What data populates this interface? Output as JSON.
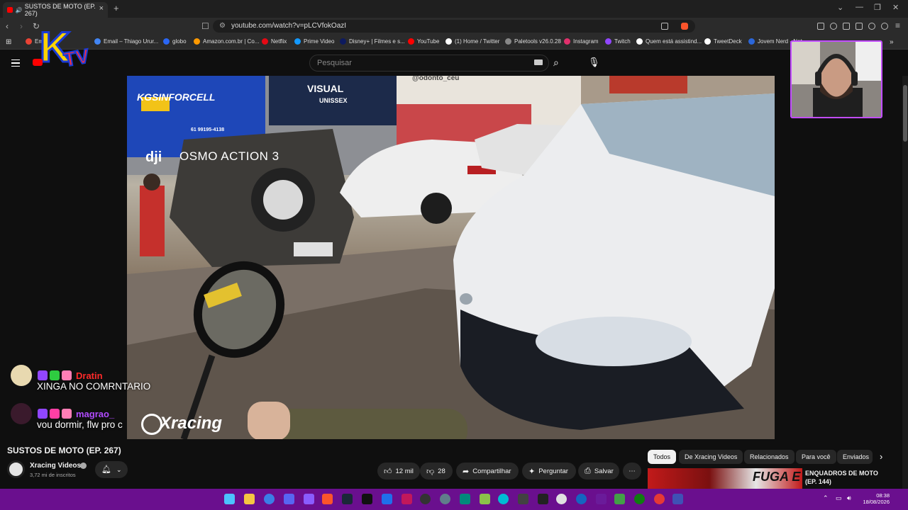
{
  "browser": {
    "tab_title": "SUSTOS DE MOTO (EP. 267)",
    "new_tab_symbol": "+",
    "url": "youtube.com/watch?v=pLCVfokOazI",
    "bookmarks": [
      {
        "label": "Em",
        "color": "#ea4335"
      },
      {
        "label": "Email – Thiago Urur...",
        "color": "#4285f4"
      },
      {
        "label": "globo",
        "color": "#2a66f4"
      },
      {
        "label": "Amazon.com.br | Co...",
        "color": "#ff9900"
      },
      {
        "label": "Netflix",
        "color": "#e50914"
      },
      {
        "label": "Prime Video",
        "color": "#1399ff"
      },
      {
        "label": "Disney+ | Filmes e s...",
        "color": "#0d1a5f"
      },
      {
        "label": "YouTube",
        "color": "#ff0000"
      },
      {
        "label": "(1) Home / Twitter",
        "color": "#ffffff"
      },
      {
        "label": "Paletools v26.0.28",
        "color": "#888888"
      },
      {
        "label": "Instagram",
        "color": "#e1306c"
      },
      {
        "label": "Twitch",
        "color": "#9146ff"
      },
      {
        "label": "Quem está assistind...",
        "color": "#ffffff"
      },
      {
        "label": "TweetDeck",
        "color": "#ffffff"
      },
      {
        "label": "Jovem Nerd - Not...",
        "color": "#2b66d9"
      }
    ]
  },
  "youtube": {
    "search_placeholder": "Pesquisar",
    "video_title": "SUSTOS DE MOTO (EP. 267)",
    "channel_name": "Xracing Videos",
    "subscribers": "3,72 mi de inscritos",
    "likes": "12 mil",
    "dislikes": "28",
    "share_label": "Compartilhar",
    "ask_label": "Perguntar",
    "save_label": "Salvar",
    "chips": [
      "Todos",
      "De Xracing Videos",
      "Relacionados",
      "Para você",
      "Enviados"
    ],
    "related_title": "ENQUADROS DE MOTO (EP. 144)",
    "related_thumb_text": "FUGA E"
  },
  "video_overlay": {
    "camera_brand": "dji",
    "camera_model": "OSMO ACTION 3",
    "watermark": "Xracing",
    "sign_kgs": "KGSINFORCELL",
    "sign_kgs_phone": "61 99195-4138",
    "sign_visual": "VISUAL",
    "sign_visual_sub": "UNISSEX",
    "sign_odonto": "@odonto_ceu"
  },
  "chat": [
    {
      "user": "Dratin",
      "message": "XINGA NO COMRNTARIO",
      "color": "#ff2a2a"
    },
    {
      "user": "magrao_",
      "message": "vou dormir, flw pro c",
      "color": "#b14bff"
    }
  ],
  "stream_logo": {
    "letter": "K",
    "text": "TV"
  },
  "taskbar": {
    "time": "08:38",
    "date": "18/08/2026"
  }
}
